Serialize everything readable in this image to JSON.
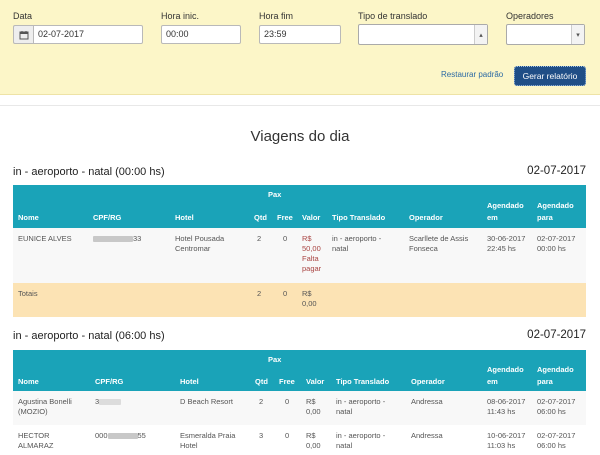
{
  "filters": {
    "data_label": "Data",
    "data_value": "02-07-2017",
    "hora_inic_label": "Hora inic.",
    "hora_inic_value": "00:00",
    "hora_fim_label": "Hora fim",
    "hora_fim_value": "23:59",
    "tipo_label": "Tipo de translado",
    "tipo_value": "",
    "operadores_label": "Operadores",
    "operadores_value": "",
    "restaurar_label": "Restaurar padrão",
    "gerar_label": "Gerar relatório"
  },
  "page_title": "Viagens do dia",
  "headers": {
    "pax": "Pax",
    "nome": "Nome",
    "cpf": "CPF/RG",
    "hotel": "Hotel",
    "qtd": "Qtd",
    "free": "Free",
    "valor": "Valor",
    "tipo": "Tipo Translado",
    "operador": "Operador",
    "agendado_em_1": "Agendado",
    "agendado_em_2": "em",
    "agendado_para_1": "Agendado",
    "agendado_para_2": "para"
  },
  "sections": [
    {
      "title": "in - aeroporto - natal (00:00 hs)",
      "date": "02-07-2017",
      "rows": [
        {
          "nome": "EUNICE ALVES",
          "cpf_suffix": "33",
          "hotel_1": "Hotel Pousada",
          "hotel_2": "Centromar",
          "qtd": "2",
          "free": "0",
          "valor_1": "R$",
          "valor_2": "50,00",
          "valor_3": "Falta",
          "valor_4": "pagar",
          "tipo_1": "in - aeroporto -",
          "tipo_2": "natal",
          "operador_1": "Scarllete de Assis",
          "operador_2": "Fonseca",
          "em_1": "30-06-2017",
          "em_2": "22:45 hs",
          "para_1": "02-07-2017",
          "para_2": "00:00 hs"
        }
      ],
      "totals": {
        "label": "Totais",
        "qtd": "2",
        "free": "0",
        "valor_1": "R$",
        "valor_2": "0,00"
      }
    },
    {
      "title": "in - aeroporto - natal (06:00 hs)",
      "date": "02-07-2017",
      "rows": [
        {
          "nome_1": "Agustina Bonelli",
          "nome_2": "(MOZIO)",
          "cpf_prefix": "3",
          "hotel_1": "D Beach Resort",
          "qtd": "2",
          "free": "0",
          "valor_1": "R$",
          "valor_2": "0,00",
          "tipo_1": "in - aeroporto -",
          "tipo_2": "natal",
          "operador_1": "Andressa",
          "em_1": "08-06-2017",
          "em_2": "11:43 hs",
          "para_1": "02-07-2017",
          "para_2": "06:00 hs"
        },
        {
          "nome_1": "HECTOR",
          "nome_2": "ALMARAZ",
          "cpf_prefix": "000",
          "cpf_suffix": "55",
          "hotel_1": "Esmeralda Praia",
          "hotel_2": "Hotel",
          "qtd": "3",
          "free": "0",
          "valor_1": "R$",
          "valor_2": "0,00",
          "tipo_1": "in - aeroporto -",
          "tipo_2": "natal",
          "operador_1": "Andressa",
          "em_1": "10-06-2017",
          "em_2": "11:03 hs",
          "para_1": "02-07-2017",
          "para_2": "06:00 hs"
        }
      ]
    }
  ],
  "icons": {
    "calendar": "calendar-icon",
    "select_arrow": "chevron-updown-icon"
  },
  "colors": {
    "filter_bg": "#fcf6c8",
    "table_header": "#1aa3b8",
    "totals_bg": "#fce3b4",
    "button": "#1f4e86",
    "money": "#a94442"
  }
}
